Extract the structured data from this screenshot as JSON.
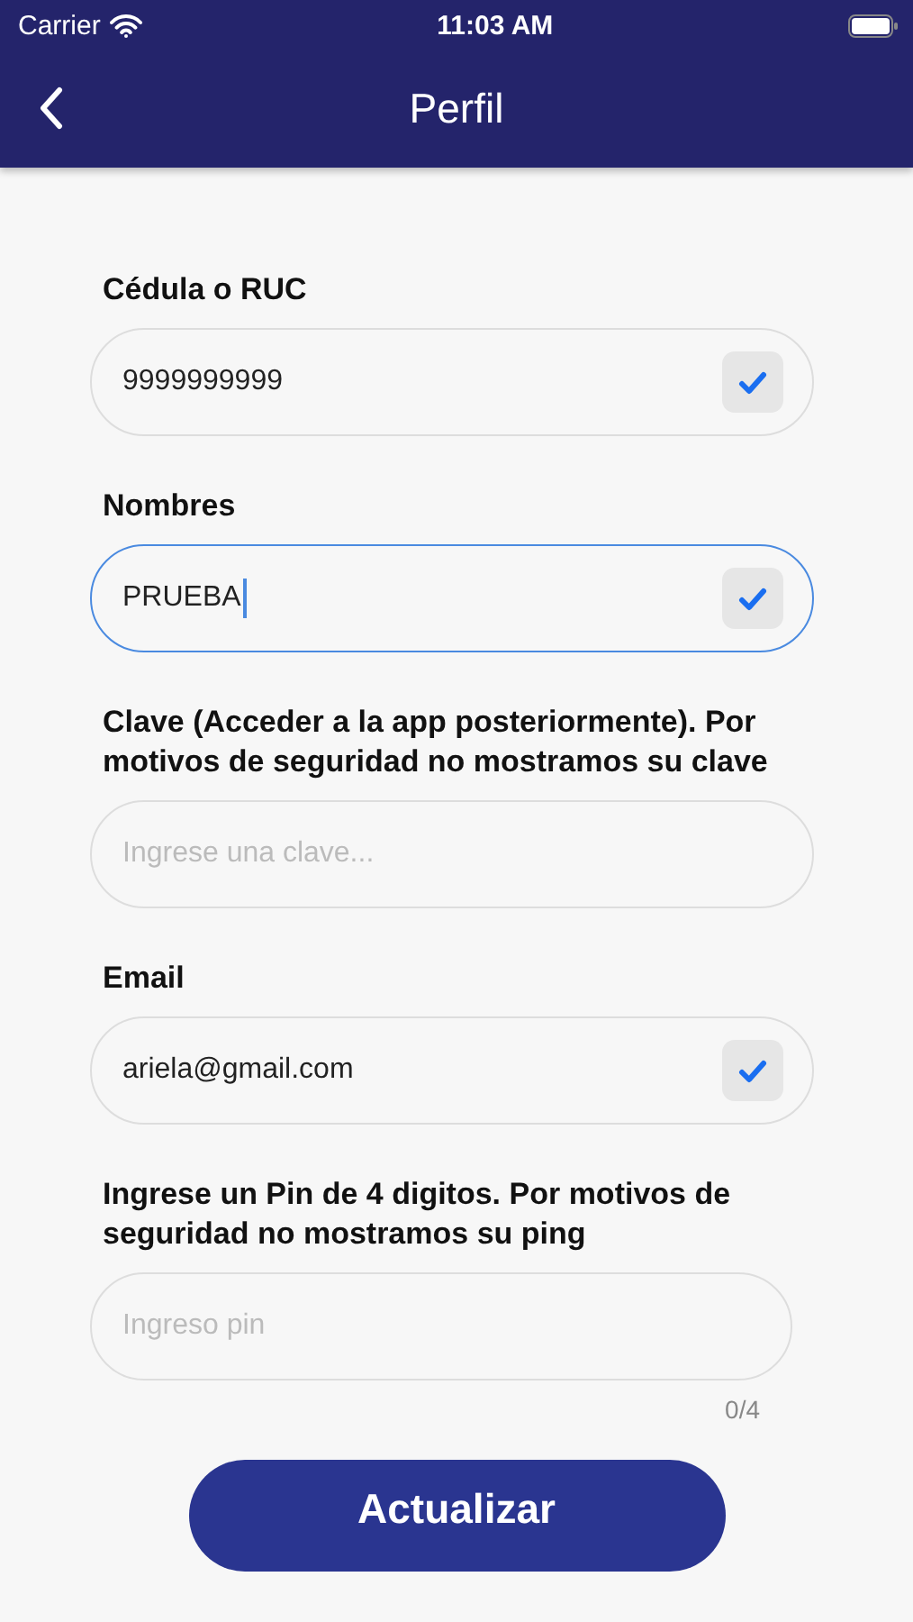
{
  "status_bar": {
    "carrier": "Carrier",
    "time": "11:03 AM"
  },
  "header": {
    "title": "Perfil"
  },
  "fields": [
    {
      "kind": "text",
      "label": "Cédula o RUC",
      "value": "9999999999",
      "valid": true,
      "focused": false
    },
    {
      "kind": "text",
      "label": "Nombres",
      "value": "PRUEBA",
      "valid": true,
      "focused": true
    },
    {
      "kind": "text",
      "label": "Clave (Acceder a la app posteriormente). Por motivos de seguridad no mostramos su clave",
      "placeholder": "Ingrese una clave...",
      "valid": false,
      "focused": false
    },
    {
      "kind": "text",
      "label": "Email",
      "value": "ariela@gmail.com",
      "valid": true,
      "focused": false
    },
    {
      "kind": "pin",
      "label": "Ingrese un Pin de 4 digitos. Por motivos de seguridad no mostramos su ping",
      "placeholder": "Ingreso pin",
      "valid": false,
      "focused": false,
      "counter": "0/4"
    }
  ],
  "submit_button": "Actualizar"
}
